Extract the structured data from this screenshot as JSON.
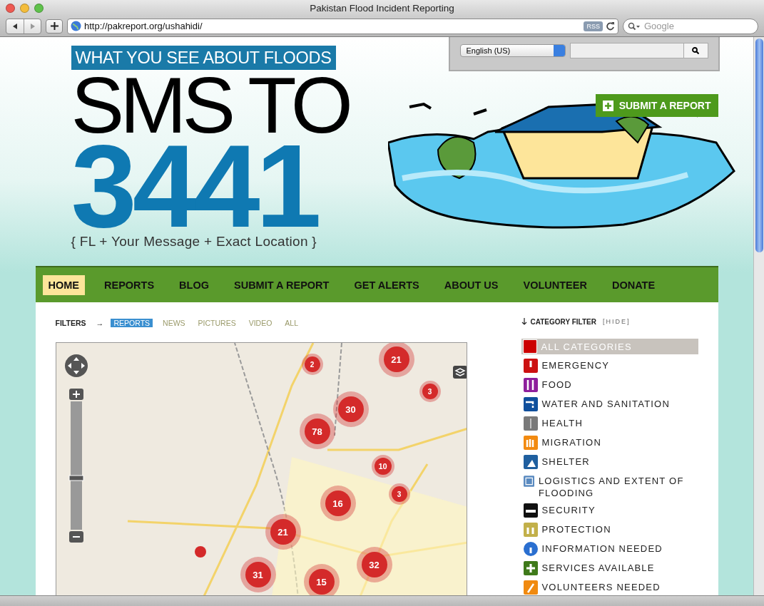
{
  "window": {
    "title": "Pakistan Flood Incident Reporting"
  },
  "toolbar": {
    "url": "http://pakreport.org/ushahidi/",
    "rss": "RSS",
    "search_placeholder": "Google"
  },
  "language": {
    "value": "English (US)"
  },
  "header": {
    "tagline": "WHAT YOU SEE ABOUT FLOODS",
    "headline": "SMS TO",
    "number": "3441",
    "instructions": "{ FL + Your Message + Exact Location }",
    "submit": "SUBMIT A REPORT"
  },
  "nav": [
    {
      "label": "HOME",
      "selected": true
    },
    {
      "label": "REPORTS",
      "selected": false
    },
    {
      "label": "BLOG",
      "selected": false
    },
    {
      "label": "SUBMIT A REPORT",
      "selected": false
    },
    {
      "label": "GET ALERTS",
      "selected": false
    },
    {
      "label": "ABOUT US",
      "selected": false
    },
    {
      "label": "VOLUNTEER",
      "selected": false
    },
    {
      "label": "DONATE",
      "selected": false
    }
  ],
  "filters": {
    "label": "FILTERS",
    "arrow": "→",
    "tabs": [
      {
        "label": "REPORTS",
        "selected": true
      },
      {
        "label": "NEWS",
        "selected": false
      },
      {
        "label": "PICTURES",
        "selected": false
      },
      {
        "label": "VIDEO",
        "selected": false
      },
      {
        "label": "ALL",
        "selected": false
      }
    ]
  },
  "map": {
    "markers": [
      {
        "count": "2",
        "kind": "small"
      },
      {
        "count": "21",
        "kind": "large"
      },
      {
        "count": "3",
        "kind": "small"
      },
      {
        "count": "30",
        "kind": "large"
      },
      {
        "count": "78",
        "kind": "large"
      },
      {
        "count": "10",
        "kind": "medium"
      },
      {
        "count": "16",
        "kind": "large"
      },
      {
        "count": "3",
        "kind": "small"
      },
      {
        "count": "21",
        "kind": "large"
      },
      {
        "count": "32",
        "kind": "large"
      },
      {
        "count": "31",
        "kind": "large"
      },
      {
        "count": "15",
        "kind": "large"
      }
    ]
  },
  "category_filter": {
    "title": "CATEGORY FILTER",
    "toggle": "[HIDE]",
    "items": [
      {
        "label": "ALL CATEGORIES",
        "kind": "all",
        "color": "#cc0000",
        "selected": true
      },
      {
        "label": "EMERGENCY",
        "kind": "emergency",
        "color": "#cc1111",
        "selected": false
      },
      {
        "label": "FOOD",
        "kind": "food",
        "color": "#8e1f9c",
        "selected": false
      },
      {
        "label": "WATER AND SANITATION",
        "kind": "water",
        "color": "#0f4f9c",
        "selected": false
      },
      {
        "label": "HEALTH",
        "kind": "health",
        "color": "#7a7a7a",
        "selected": false
      },
      {
        "label": "MIGRATION",
        "kind": "migration",
        "color": "#f28a10",
        "selected": false
      },
      {
        "label": "SHELTER",
        "kind": "shelter",
        "color": "#1f5f9f",
        "selected": false
      },
      {
        "label": "LOGISTICS AND EXTENT OF FLOODING",
        "kind": "logistics",
        "color": "#5a8ac0",
        "selected": false
      },
      {
        "label": "SECURITY",
        "kind": "security",
        "color": "#111111",
        "selected": false
      },
      {
        "label": "PROTECTION",
        "kind": "protection",
        "color": "#c2b04a",
        "selected": false
      },
      {
        "label": "INFORMATION NEEDED",
        "kind": "info",
        "color": "#2a6fd0",
        "selected": false
      },
      {
        "label": "SERVICES AVAILABLE",
        "kind": "services",
        "color": "#3f7a1a",
        "selected": false
      },
      {
        "label": "VOLUNTEERS NEEDED",
        "kind": "volunteers",
        "color": "#f08a10",
        "selected": false
      }
    ]
  }
}
